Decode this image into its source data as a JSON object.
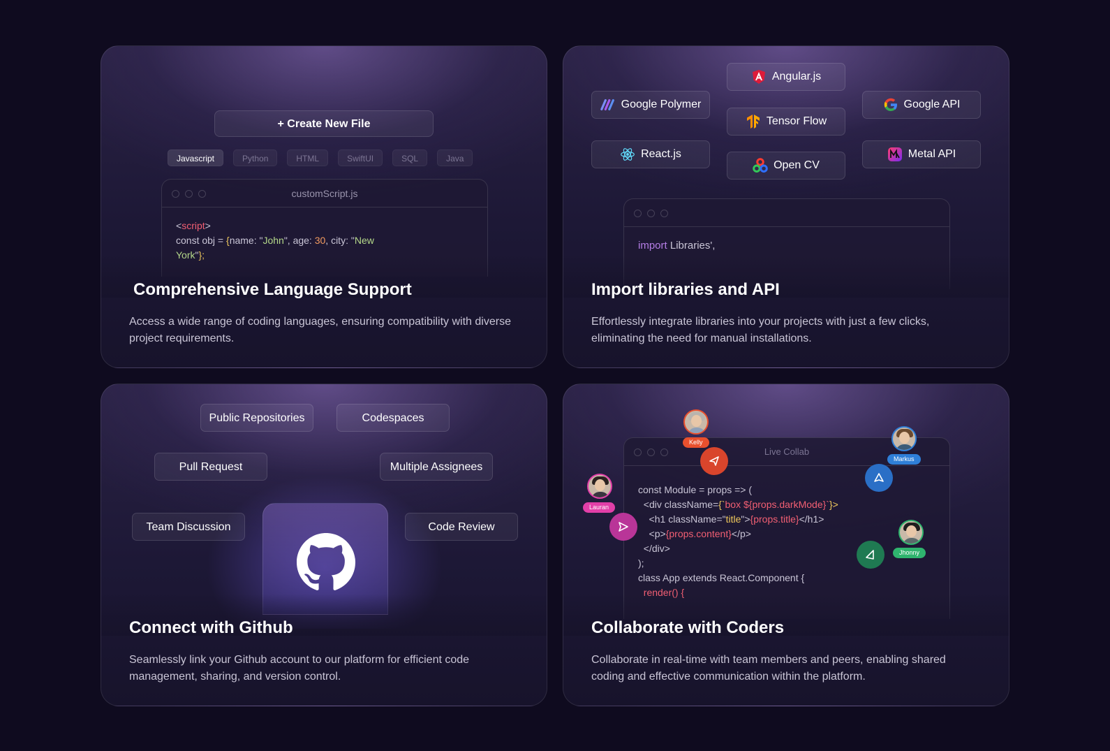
{
  "cards": {
    "language": {
      "title": "Comprehensive Language Support",
      "description": "Access a wide range of coding languages, ensuring compatibility with diverse project requirements.",
      "create_button": "+ Create New File",
      "tabs": [
        "Javascript",
        "Python",
        "HTML",
        "SwiftUI",
        "SQL",
        "Java"
      ],
      "active_tab": "Javascript",
      "editor_title": "customScript.js",
      "code": {
        "l1_open": "<",
        "l1_tag": "script",
        "l1_close": ">",
        "l2_a": "const obj = ",
        "l2_b": "{",
        "l2_c": "name: \"",
        "l2_d": "John",
        "l2_e": "\", age: ",
        "l2_f": "30",
        "l2_g": ", city: \"",
        "l2_h": "New",
        "l3_a": "York",
        "l3_b": "\"",
        "l3_c": "};"
      }
    },
    "libraries": {
      "title": "Import libraries and API",
      "description": "Effortlessly integrate libraries into your projects with just a few clicks, eliminating the need for manual installations.",
      "items": [
        "Google Polymer",
        "Angular.js",
        "Google API",
        "Tensor Flow",
        "React.js",
        "Open CV",
        "Metal API"
      ],
      "code_keyword": "import",
      "code_rest": " Libraries',"
    },
    "github": {
      "title": "Connect with Github",
      "description": "Seamlessly link your Github account to our platform for efficient code management, sharing, and version control.",
      "tags": [
        "Public Repositories",
        "Codespaces",
        "Pull Request",
        "Multiple Assignees",
        "Team Discussion",
        "Code Review"
      ]
    },
    "collab": {
      "title": "Collaborate with Coders",
      "description": "Collaborate in real-time with team members and peers, enabling shared coding and effective communication within the platform.",
      "editor_title": "Live Collab",
      "users": [
        "Kelly",
        "Markus",
        "Lauran",
        "Jhonny"
      ],
      "colors": {
        "kelly": "#e8502e",
        "markus": "#2f7fd8",
        "lauran": "#e23fa8",
        "jhonny": "#2fb46e"
      },
      "code": {
        "l1": "const Module = props => (",
        "l2_a": "  <div className=",
        "l2_b": "{`",
        "l2_c": "box ${",
        "l2_d": "props.darkMode",
        "l2_e": "}`",
        "l2_f": "}>",
        "l3_a": "    <h1 className=\"",
        "l3_b": "title",
        "l3_c": "\">",
        "l3_d": "{props.title}",
        "l3_e": "</h1>",
        "l4_a": "    <p>",
        "l4_b": "{props.content}",
        "l4_c": "</p>",
        "l5": "  </div>",
        "l6": ");",
        "l7": "class App extends React.Component {",
        "l8": "  render() {"
      }
    }
  }
}
